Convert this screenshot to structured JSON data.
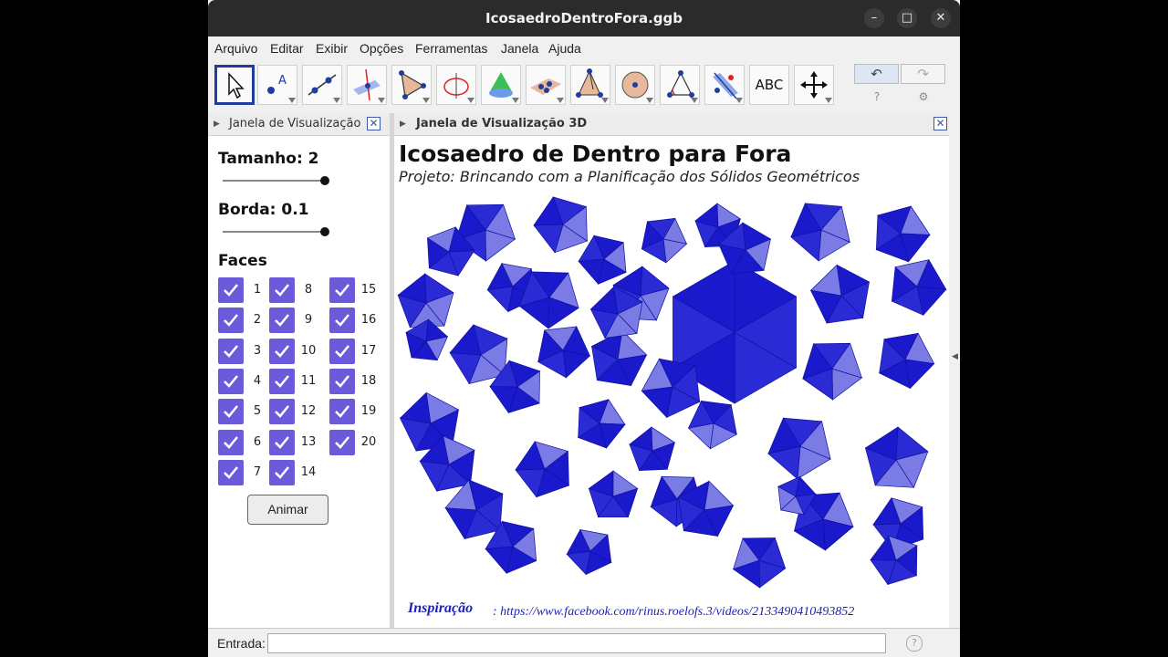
{
  "window": {
    "title": "IcosaedroDentroFora.ggb"
  },
  "menu": [
    "Arquivo",
    "Editar",
    "Exibir",
    "Opções",
    "Ferramentas",
    "Janela",
    "Ajuda"
  ],
  "toolbar": {
    "tools": [
      {
        "name": "move-tool-icon",
        "selected": true
      },
      {
        "name": "point-tool-icon"
      },
      {
        "name": "line-tool-icon"
      },
      {
        "name": "perpendicular-tool-icon"
      },
      {
        "name": "polygon-tool-icon"
      },
      {
        "name": "circle-tool-icon"
      },
      {
        "name": "cone-tool-icon"
      },
      {
        "name": "plane-tool-icon"
      },
      {
        "name": "pyramid-tool-icon"
      },
      {
        "name": "sphere-tool-icon"
      },
      {
        "name": "angle-tool-icon"
      },
      {
        "name": "reflect-tool-icon"
      },
      {
        "name": "text-tool-icon",
        "label": "ABC"
      },
      {
        "name": "move-view-tool-icon"
      }
    ],
    "undo": "↶",
    "redo": "↷",
    "help": "?",
    "settings": "⚙"
  },
  "left_panel": {
    "header": "Janela de Visualização",
    "slider1_label": "Tamanho: 2",
    "slider1_fraction": 1.0,
    "slider2_label": "Borda: 0.1",
    "slider2_fraction": 1.0,
    "faces_label": "Faces",
    "faces": [
      {
        "n": "1",
        "checked": true
      },
      {
        "n": "2",
        "checked": true
      },
      {
        "n": "3",
        "checked": true
      },
      {
        "n": "4",
        "checked": true
      },
      {
        "n": "5",
        "checked": true
      },
      {
        "n": "6",
        "checked": true
      },
      {
        "n": "7",
        "checked": true
      },
      {
        "n": "8",
        "checked": true
      },
      {
        "n": "9",
        "checked": true
      },
      {
        "n": "10",
        "checked": true
      },
      {
        "n": "11",
        "checked": true
      },
      {
        "n": "12",
        "checked": true
      },
      {
        "n": "13",
        "checked": true
      },
      {
        "n": "14",
        "checked": true
      },
      {
        "n": "15",
        "checked": true
      },
      {
        "n": "16",
        "checked": true
      },
      {
        "n": "17",
        "checked": true
      },
      {
        "n": "18",
        "checked": true
      },
      {
        "n": "19",
        "checked": true
      },
      {
        "n": "20",
        "checked": true
      }
    ],
    "animar": "Animar"
  },
  "right_panel": {
    "header": "Janela de Visualização 3D",
    "title": "Icosaedro de Dentro para Fora",
    "subtitle": "Projeto: Brincando com a Planificação dos Sólidos Geométricos",
    "inspiracao_label": "Inspiração",
    "inspiracao_url": ": https://www.facebook.com/rinus.roelofs.3/videos/2133490410493852",
    "colors": {
      "dark": "#1a1acc",
      "mid": "#2b2bd6",
      "light": "#7b7be6",
      "edge": "#1010a0"
    }
  },
  "input_bar": {
    "label": "Entrada:",
    "value": "",
    "help": "?"
  }
}
